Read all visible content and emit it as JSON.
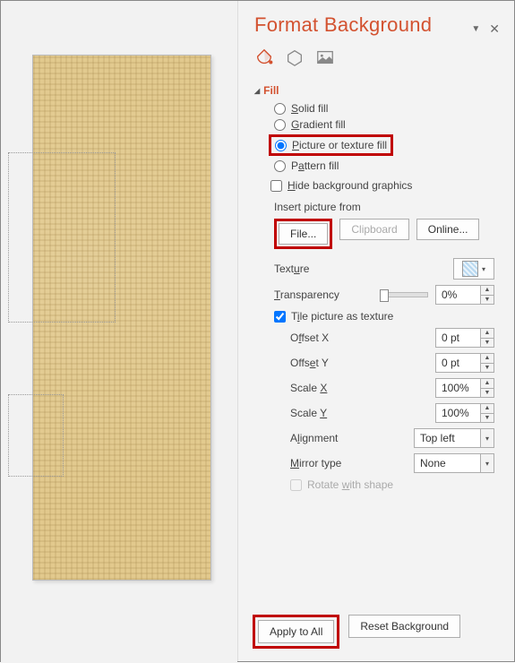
{
  "panel": {
    "title": "Format Background",
    "section": "Fill",
    "radios": {
      "solid": "Solid fill",
      "gradient": "Gradient fill",
      "picture_texture": "Picture or texture fill",
      "pattern": "Pattern fill",
      "selected": "picture_texture"
    },
    "hide_bg_label": "Hide background graphics",
    "hide_bg_checked": false,
    "insert_from_label": "Insert picture from",
    "buttons": {
      "file": "File...",
      "clipboard": "Clipboard",
      "online": "Online..."
    },
    "texture_label": "Texture",
    "transparency_label": "Transparency",
    "transparency_value": "0%",
    "tile_label": "Tile picture as texture",
    "tile_checked": true,
    "offset_x_label": "Offset X",
    "offset_x_value": "0 pt",
    "offset_y_label": "Offset Y",
    "offset_y_value": "0 pt",
    "scale_x_label": "Scale X",
    "scale_x_value": "100%",
    "scale_y_label": "Scale Y",
    "scale_y_value": "100%",
    "alignment_label": "Alignment",
    "alignment_value": "Top left",
    "mirror_label": "Mirror type",
    "mirror_value": "None",
    "rotate_label": "Rotate with shape"
  },
  "footer": {
    "apply_all": "Apply to All",
    "reset": "Reset Background"
  }
}
